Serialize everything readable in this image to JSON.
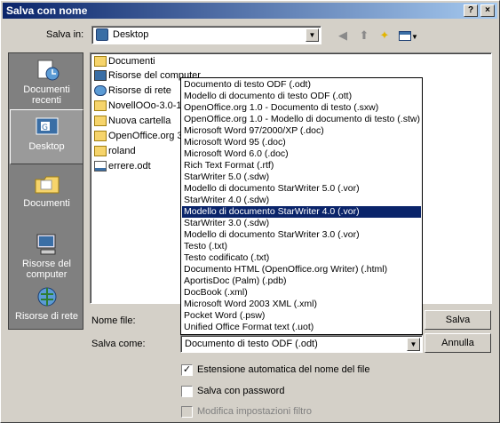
{
  "window": {
    "title": "Salva con nome",
    "help": "?",
    "close": "×"
  },
  "toolbar": {
    "save_in_label": "Salva in:",
    "save_in_value": "Desktop"
  },
  "places": [
    {
      "label": "Documenti recenti"
    },
    {
      "label": "Desktop"
    },
    {
      "label": "Documenti"
    },
    {
      "label": "Risorse del computer"
    },
    {
      "label": "Risorse di rete"
    }
  ],
  "files": [
    {
      "name": "Documenti"
    },
    {
      "name": "Risorse del computer"
    },
    {
      "name": "Risorse di rete"
    },
    {
      "name": "NovellOOo-3.0-1t"
    },
    {
      "name": "Nuova cartella"
    },
    {
      "name": "OpenOffice.org 3"
    },
    {
      "name": "roland"
    },
    {
      "name": "errere.odt"
    }
  ],
  "form": {
    "filename_label": "Nome file:",
    "saveas_label": "Salva come:",
    "saveas_value": "Documento di testo ODF (.odt)",
    "save_button": "Salva",
    "cancel_button": "Annulla",
    "auto_ext": "Estensione automatica del nome del file",
    "password": "Salva con password",
    "filter": "Modifica impostazioni filtro"
  },
  "dropdown_options": [
    "Documento di testo ODF (.odt)",
    "Modello di documento di testo ODF (.ott)",
    "OpenOffice.org 1.0 - Documento di testo (.sxw)",
    "OpenOffice.org 1.0 - Modello di documento di testo (.stw)",
    "Microsoft Word 97/2000/XP (.doc)",
    "Microsoft Word 95 (.doc)",
    "Microsoft Word 6.0 (.doc)",
    "Rich Text Format (.rtf)",
    "StarWriter 5.0 (.sdw)",
    "Modello di documento StarWriter 5.0 (.vor)",
    "StarWriter 4.0 (.sdw)",
    "Modello di documento StarWriter 4.0 (.vor)",
    "StarWriter 3.0 (.sdw)",
    "Modello di documento StarWriter 3.0 (.vor)",
    "Testo (.txt)",
    "Testo codificato (.txt)",
    "Documento HTML (OpenOffice.org Writer) (.html)",
    "AportisDoc (Palm) (.pdb)",
    "DocBook (.xml)",
    "Microsoft Word 2003 XML (.xml)",
    "Pocket Word (.psw)",
    "Unified Office Format text (.uot)"
  ],
  "highlighted_index": 11,
  "colors": {
    "title_start": "#0a246a",
    "highlight": "#0a246a",
    "face": "#d4d0c8"
  }
}
